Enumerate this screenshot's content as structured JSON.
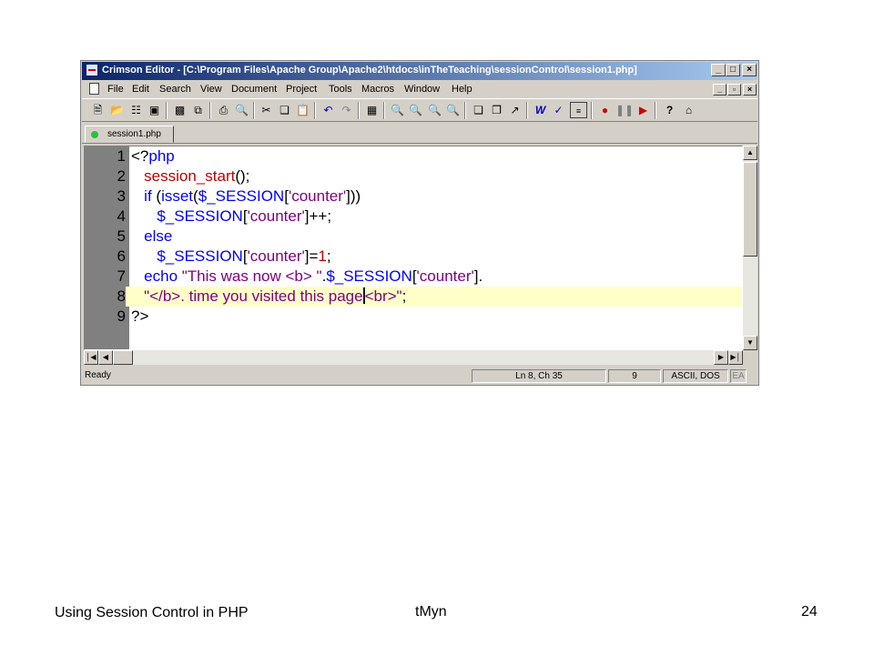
{
  "window": {
    "title": "Crimson Editor - [C:\\Program Files\\Apache Group\\Apache2\\htdocs\\inTheTeaching\\sessionControl\\session1.php]",
    "caption_buttons": [
      "_",
      "□",
      "×"
    ]
  },
  "menubar": {
    "items": [
      "File",
      "Edit",
      "Search",
      "View",
      "Document",
      "Project",
      "Tools",
      "Macros",
      "Window",
      "Help"
    ],
    "mdi_buttons": [
      "_",
      "▫",
      "×"
    ]
  },
  "toolbar": {
    "icons": [
      "new-file-icon",
      "open-file-icon",
      "open-remote-icon",
      "project-icon",
      "save-icon",
      "save-all-icon",
      "print-icon",
      "print-preview-icon",
      "cut-icon",
      "copy-icon",
      "paste-icon",
      "undo-icon",
      "redo-icon",
      "column-mode-icon",
      "find-icon",
      "find-next-icon",
      "replace-icon",
      "find-in-files-icon",
      "window-tile-icon",
      "window-cascade-icon",
      "goto-icon",
      "word-wrap-icon",
      "spell-check-icon",
      "line-numbers-icon",
      "record-macro-icon",
      "pause-macro-icon",
      "play-macro-icon",
      "help-icon",
      "home-icon"
    ]
  },
  "tab": {
    "label": "session1.php"
  },
  "editor": {
    "current_line": 8,
    "lines": [
      {
        "n": "1",
        "segments": [
          {
            "t": "<?",
            "c": "#000000"
          },
          {
            "t": "php",
            "c": "#0000ff"
          }
        ]
      },
      {
        "n": "2",
        "segments": [
          {
            "t": "   session_start",
            "c": "#c00000"
          },
          {
            "t": "();",
            "c": "#000000"
          }
        ]
      },
      {
        "n": "3",
        "segments": [
          {
            "t": "   if ",
            "c": "#0000ff"
          },
          {
            "t": "(",
            "c": "#000000"
          },
          {
            "t": "isset",
            "c": "#0000ff"
          },
          {
            "t": "(",
            "c": "#000000"
          },
          {
            "t": "$_SESSION",
            "c": "#0000ff"
          },
          {
            "t": "[",
            "c": "#000000"
          },
          {
            "t": "'counter'",
            "c": "#800080"
          },
          {
            "t": "]))",
            "c": "#000000"
          }
        ]
      },
      {
        "n": "4",
        "segments": [
          {
            "t": "      $_SESSION",
            "c": "#0000ff"
          },
          {
            "t": "[",
            "c": "#000000"
          },
          {
            "t": "'counter'",
            "c": "#800080"
          },
          {
            "t": "]++;",
            "c": "#000000"
          }
        ]
      },
      {
        "n": "5",
        "segments": [
          {
            "t": "   else",
            "c": "#0000ff"
          }
        ]
      },
      {
        "n": "6",
        "segments": [
          {
            "t": "      $_SESSION",
            "c": "#0000ff"
          },
          {
            "t": "[",
            "c": "#000000"
          },
          {
            "t": "'counter'",
            "c": "#800080"
          },
          {
            "t": "]=",
            "c": "#000000"
          },
          {
            "t": "1",
            "c": "#c00000"
          },
          {
            "t": ";",
            "c": "#000000"
          }
        ]
      },
      {
        "n": "7",
        "segments": [
          {
            "t": "   echo ",
            "c": "#0000ff"
          },
          {
            "t": "\"This was now <b> \"",
            "c": "#800080"
          },
          {
            "t": ".",
            "c": "#000000"
          },
          {
            "t": "$_SESSION",
            "c": "#0000ff"
          },
          {
            "t": "[",
            "c": "#000000"
          },
          {
            "t": "'counter'",
            "c": "#800080"
          },
          {
            "t": "].",
            "c": "#000000"
          }
        ]
      },
      {
        "n": "8",
        "segments": [
          {
            "t": "   \"</b>. time you visited this page",
            "c": "#800080"
          },
          {
            "t": "|",
            "c": "caret"
          },
          {
            "t": "<br>\"",
            "c": "#800080"
          },
          {
            "t": ";",
            "c": "#000000"
          }
        ]
      },
      {
        "n": "9",
        "segments": [
          {
            "t": "?>",
            "c": "#000000"
          }
        ]
      }
    ]
  },
  "statusbar": {
    "ready": "Ready",
    "position": "Ln 8, Ch 35",
    "tab_size": "9",
    "encoding": "ASCII, DOS",
    "extra": "EA"
  },
  "footer": {
    "left": "Using Session Control in PHP",
    "center": "tMyn",
    "page": "24"
  },
  "colors": {
    "titlebar_start": "#0a246a",
    "titlebar_end": "#a6caf0",
    "gutter": "#808080",
    "current_line": "#ffffc8",
    "keyword": "#0000ff",
    "string": "#800080",
    "function": "#c00000"
  }
}
